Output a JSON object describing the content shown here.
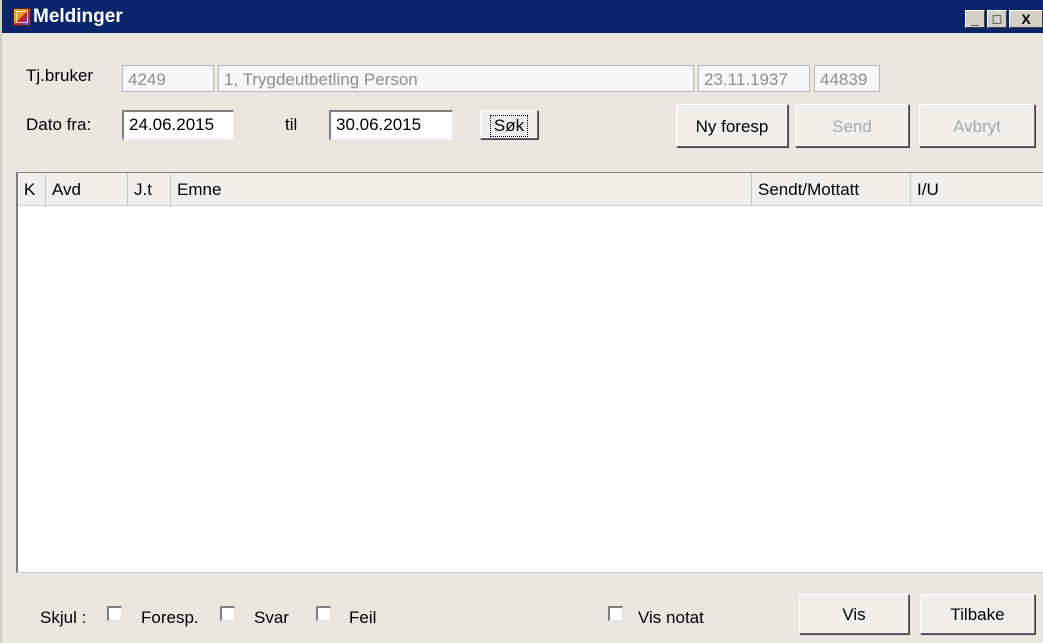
{
  "window": {
    "title": "Meldinger"
  },
  "titlebar": {
    "minimize": "_",
    "maximize": "□",
    "close": "X"
  },
  "search": {
    "tjbruker_label": "Tj.bruker",
    "user_id": "4249",
    "user_name": "1, Trygdeutbetling Person",
    "birth_date": "23.11.1937",
    "user_code": "44839",
    "dato_fra_label": "Dato fra:",
    "date_from": "24.06.2015",
    "til_label": "til",
    "date_to": "30.06.2015",
    "search_button": "Søk"
  },
  "actions": {
    "new_request": "Ny foresp",
    "send": "Send",
    "cancel": "Avbryt"
  },
  "table": {
    "columns": [
      "K",
      "Avd",
      "J.t",
      "Emne",
      "Sendt/Mottatt",
      "I/U"
    ],
    "rows": []
  },
  "footer": {
    "hide_label": "Skjul :",
    "filters": [
      {
        "label": "Foresp.",
        "checked": false
      },
      {
        "label": "Svar",
        "checked": false
      },
      {
        "label": "Feil",
        "checked": false
      }
    ],
    "show_note": {
      "label": "Vis notat",
      "checked": false
    },
    "show_button": "Vis",
    "back_button": "Tilbake"
  }
}
